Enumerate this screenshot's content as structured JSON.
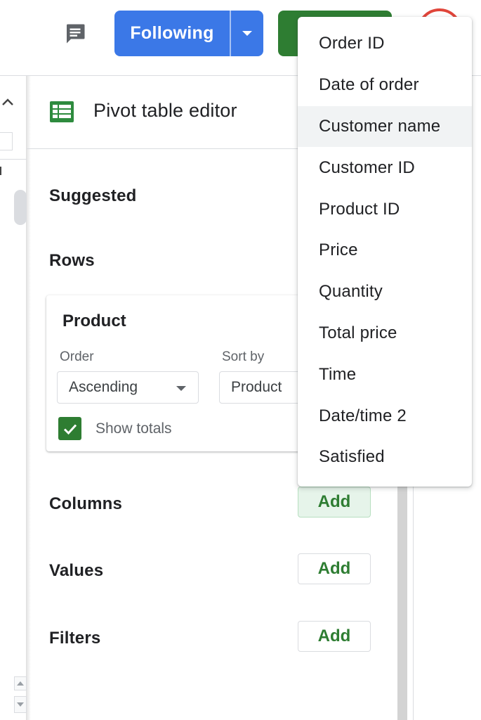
{
  "topbar": {
    "following_label": "Following",
    "comment_icon": "comment-icon",
    "dropdown_icon": "caret-down-icon"
  },
  "panel": {
    "title": "Pivot table editor",
    "suggested_label": "Suggested",
    "rows_label": "Rows",
    "columns_label": "Columns",
    "values_label": "Values",
    "filters_label": "Filters",
    "add_label": "Add"
  },
  "product_card": {
    "title": "Product",
    "order_label": "Order",
    "order_value": "Ascending",
    "sortby_label": "Sort by",
    "sortby_value": "Product",
    "show_totals_label": "Show totals",
    "show_totals_checked": true
  },
  "field_menu": {
    "highlighted": "Customer name",
    "items": [
      "Order ID",
      "Date of order",
      "Customer name",
      "Customer ID",
      "Product ID",
      "Price",
      "Quantity",
      "Total price",
      "Time",
      "Date/time 2",
      "Satisfied"
    ]
  },
  "colors": {
    "primary_blue": "#3b78e7",
    "sheets_green": "#2e7d32",
    "avatar_ring": "#e0453a",
    "menu_highlight": "#f1f3f4"
  }
}
